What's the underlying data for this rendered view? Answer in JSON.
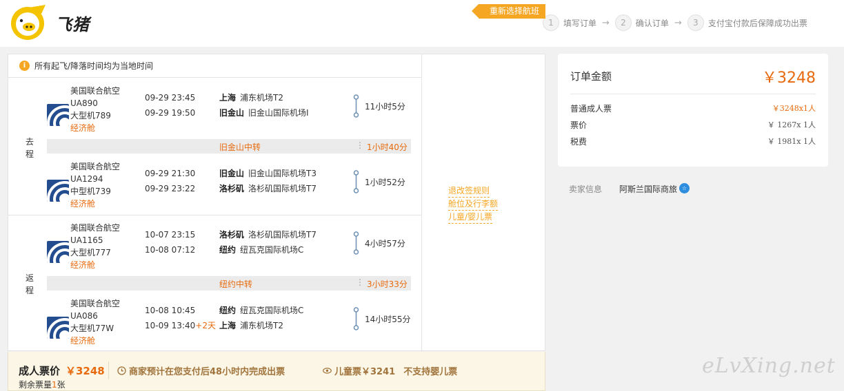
{
  "header": {
    "logo_text": "飞猪",
    "steps": [
      {
        "num": "1",
        "label": "填写订单"
      },
      {
        "num": "2",
        "label": "确认订单"
      },
      {
        "num": "3",
        "label": "支付宝付款后保障成功出票"
      }
    ],
    "step_arrow": "→"
  },
  "notice": {
    "icon": "i",
    "text": "所有起飞/降落时间均为当地时间"
  },
  "reselect_label": "重新选择航班",
  "policy_links": [
    "退改签规则",
    "舱位及行李额",
    "儿童/婴儿票"
  ],
  "outbound": {
    "label": "去程",
    "flights": [
      {
        "airline": "美国联合航空",
        "flight_no": "UA890",
        "aircraft": "大型机789",
        "cabin": "经济舱",
        "dep_time": "09-29 23:45",
        "arr_time": "09-29 19:50",
        "arr_plus": "",
        "dep_city": "上海",
        "dep_airport": "浦东机场T2",
        "arr_city": "旧金山",
        "arr_airport": "旧金山国际机场I",
        "duration": "11小时5分"
      },
      {
        "airline": "美国联合航空",
        "flight_no": "UA1294",
        "aircraft": "中型机739",
        "cabin": "经济舱",
        "dep_time": "09-29 21:30",
        "arr_time": "09-29 23:22",
        "arr_plus": "",
        "dep_city": "旧金山",
        "dep_airport": "旧金山国际机场T3",
        "arr_city": "洛杉矶",
        "arr_airport": "洛杉矶国际机场T7",
        "duration": "1小时52分"
      }
    ],
    "transfer": {
      "city": "旧金山中转",
      "sep": "⋮",
      "duration": "1小时40分"
    }
  },
  "return": {
    "label": "返程",
    "flights": [
      {
        "airline": "美国联合航空",
        "flight_no": "UA1165",
        "aircraft": "大型机777",
        "cabin": "经济舱",
        "dep_time": "10-07 23:15",
        "arr_time": "10-08 07:12",
        "arr_plus": "",
        "dep_city": "洛杉矶",
        "dep_airport": "洛杉矶国际机场T7",
        "arr_city": "纽约",
        "arr_airport": "纽瓦克国际机场C",
        "duration": "4小时57分"
      },
      {
        "airline": "美国联合航空",
        "flight_no": "UA086",
        "aircraft": "大型机77W",
        "cabin": "经济舱",
        "dep_time": "10-08 10:45",
        "arr_time": "10-09 13:40",
        "arr_plus": "+2天",
        "dep_city": "纽约",
        "dep_airport": "纽瓦克国际机场C",
        "arr_city": "上海",
        "arr_airport": "浦东机场T2",
        "duration": "14小时55分"
      }
    ],
    "transfer": {
      "city": "纽约中转",
      "sep": "⋮",
      "duration": "3小时33分"
    }
  },
  "bottom": {
    "price_label": "成人票价",
    "price": "￥3248",
    "remain_label": "剩余票量",
    "remain_count": "1",
    "remain_unit": "张",
    "ticketing_note": "商家预计在您支付后48小时内完成出票",
    "child_price": "儿童票￥3241",
    "infant_note": "不支持婴儿票"
  },
  "order": {
    "title": "订单金额",
    "total": "￥3248",
    "rows": [
      {
        "label": "普通成人票",
        "value": "￥3248x1人"
      },
      {
        "label": "票价",
        "value": "￥ 1267x 1人"
      },
      {
        "label": "税费",
        "value": "￥ 1981x 1人"
      }
    ]
  },
  "seller": {
    "label": "卖家信息",
    "name": "阿斯兰国际商旅",
    "badge": "☆"
  },
  "watermark": "eLvXing.net",
  "colors": {
    "accent": "#e8690c",
    "tag": "#f5a623",
    "bottom_bar": "#fbf6e5",
    "badge": "#2d8ee0"
  }
}
